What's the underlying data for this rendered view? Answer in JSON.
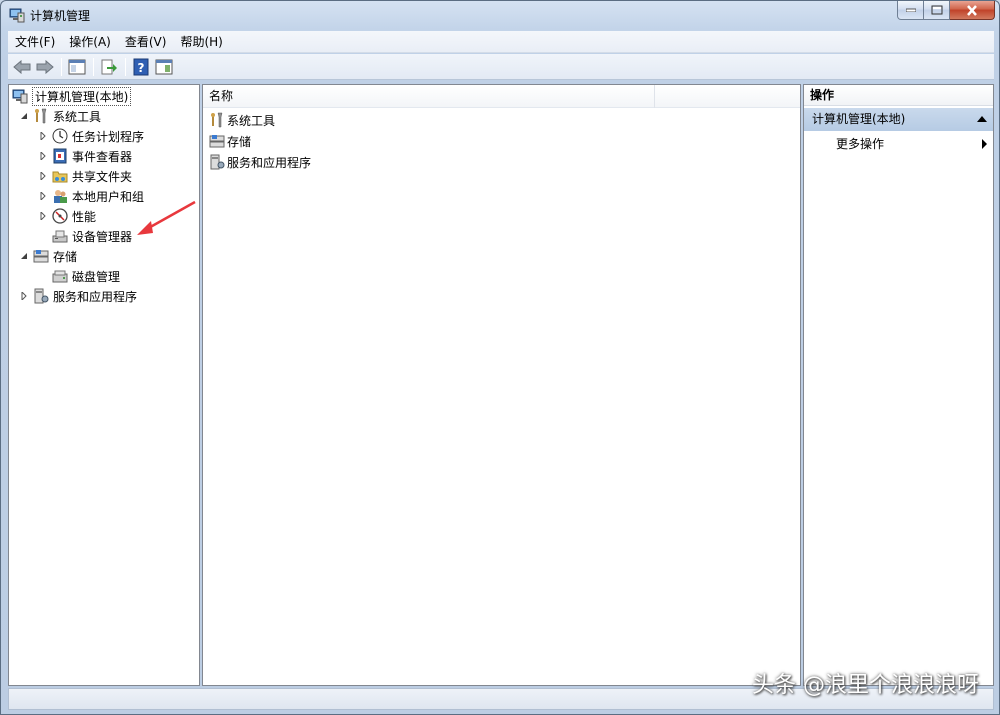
{
  "window": {
    "title": "计算机管理"
  },
  "menu": [
    {
      "label": "文件(F)"
    },
    {
      "label": "操作(A)"
    },
    {
      "label": "查看(V)"
    },
    {
      "label": "帮助(H)"
    }
  ],
  "tree": {
    "root": "计算机管理(本地)",
    "items": [
      {
        "label": "系统工具",
        "level": 1,
        "expanded": true,
        "icon": "tools-icon"
      },
      {
        "label": "任务计划程序",
        "level": 2,
        "expanded": false,
        "icon": "clock-icon"
      },
      {
        "label": "事件查看器",
        "level": 2,
        "expanded": false,
        "icon": "event-viewer-icon"
      },
      {
        "label": "共享文件夹",
        "level": 2,
        "expanded": false,
        "icon": "shared-folder-icon"
      },
      {
        "label": "本地用户和组",
        "level": 2,
        "expanded": false,
        "icon": "users-icon"
      },
      {
        "label": "性能",
        "level": 2,
        "expanded": false,
        "icon": "performance-icon"
      },
      {
        "label": "设备管理器",
        "level": 2,
        "leaf": true,
        "icon": "device-manager-icon"
      },
      {
        "label": "存储",
        "level": 1,
        "expanded": true,
        "icon": "storage-icon"
      },
      {
        "label": "磁盘管理",
        "level": 2,
        "leaf": true,
        "icon": "disk-icon"
      },
      {
        "label": "服务和应用程序",
        "level": 1,
        "expanded": false,
        "icon": "services-icon"
      }
    ]
  },
  "list": {
    "column_name": "名称",
    "rows": [
      {
        "label": "系统工具",
        "icon": "tools-icon"
      },
      {
        "label": "存储",
        "icon": "storage-icon"
      },
      {
        "label": "服务和应用程序",
        "icon": "services-icon"
      }
    ]
  },
  "actions": {
    "header": "操作",
    "section": "计算机管理(本地)",
    "more": "更多操作"
  },
  "watermark": "头条 @浪里个浪浪浪呀",
  "colors": {
    "accent_arrow": "#e8383d",
    "section_bg": "#bfd1e8"
  }
}
